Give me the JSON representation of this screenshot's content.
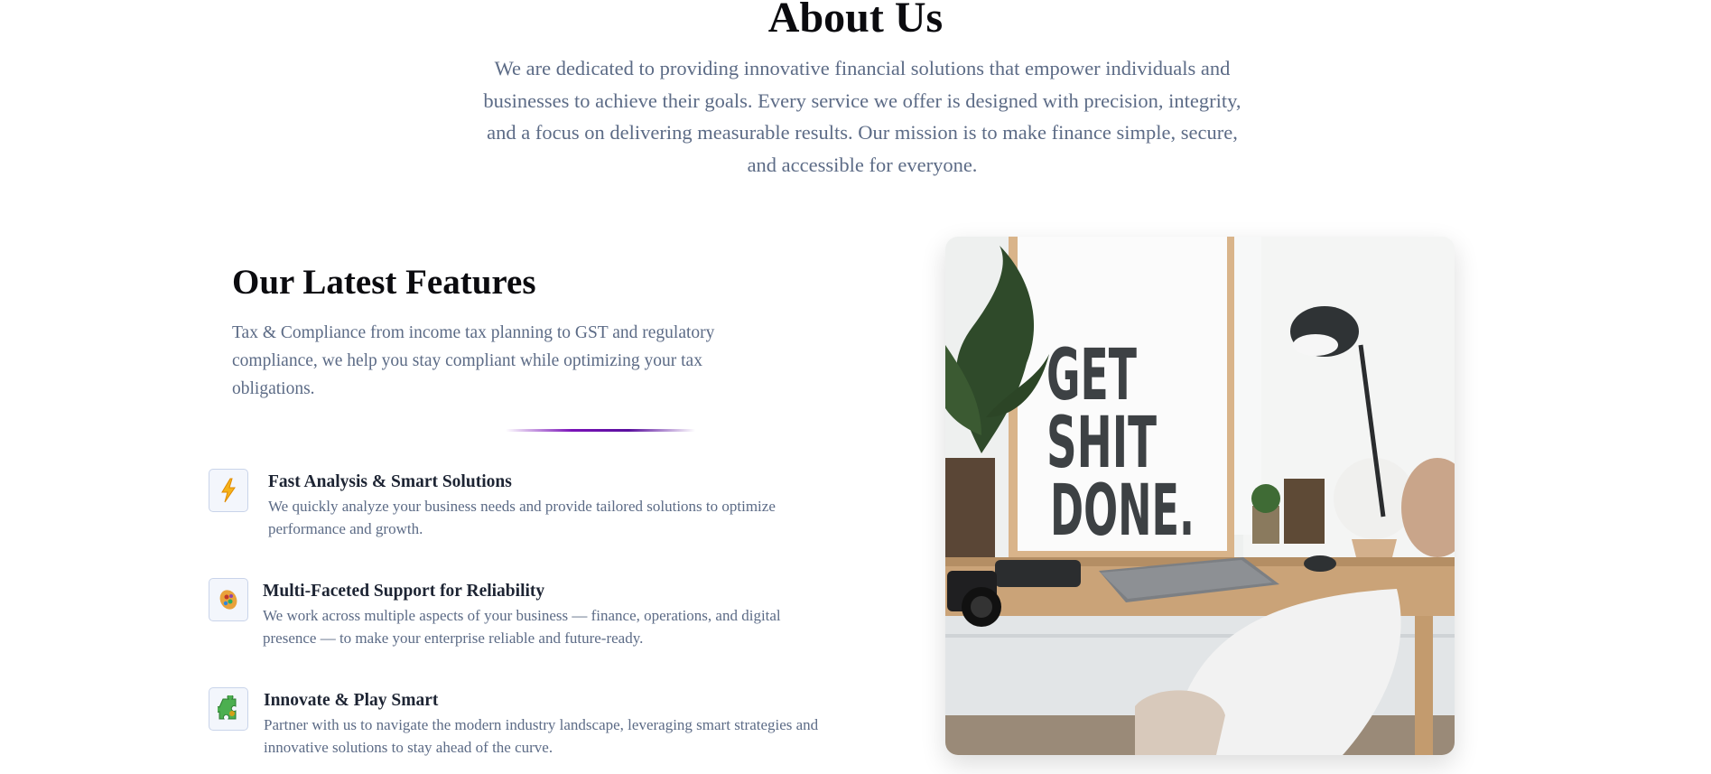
{
  "about": {
    "title": "About Us",
    "text": "We are dedicated to providing innovative financial solutions that empower individuals and businesses to achieve their goals. Every service we offer is designed with precision, integrity, and a focus on delivering measurable results. Our mission is to make finance simple, secure, and accessible for everyone."
  },
  "features": {
    "title": "Our Latest Features",
    "intro": "Tax & Compliance from income tax planning to GST and regulatory compliance, we help you stay compliant while optimizing your tax obligations.",
    "items": [
      {
        "icon": "lightning-icon",
        "title": "Fast Analysis & Smart Solutions",
        "description": "We quickly analyze your business needs and provide tailored solutions to optimize performance and growth."
      },
      {
        "icon": "palette-icon",
        "title": "Multi-Faceted Support for Reliability",
        "description": "We work across multiple aspects of your business — finance, operations, and digital presence — to make your enterprise reliable and future-ready."
      },
      {
        "icon": "puzzle-icon",
        "title": "Innovate & Play Smart",
        "description": "Partner with us to navigate the modern industry landscape, leveraging smart strategies and innovative solutions to stay ahead of the curve."
      }
    ]
  },
  "photo": {
    "poster_text": [
      "GET",
      "SHIT",
      "DONE."
    ]
  },
  "colors": {
    "heading": "#0b0b0f",
    "body_text": "#5c6b86",
    "accent": "#7a12b8",
    "icon_bg": "#f3f6fc",
    "icon_border": "#c9d4ea"
  }
}
